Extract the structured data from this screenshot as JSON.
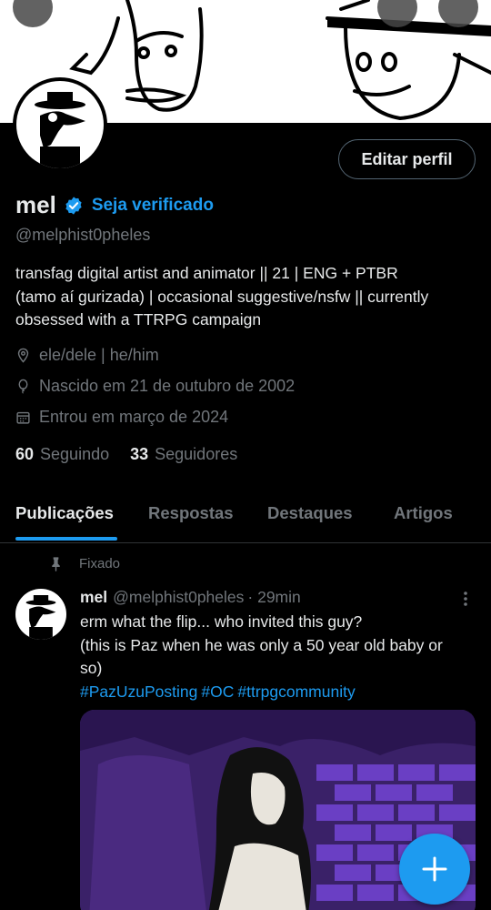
{
  "header": {
    "back_icon": "arrow-left-icon",
    "search_icon": "search-icon",
    "more_icon": "more-vertical-icon"
  },
  "profile": {
    "display_name": "mel",
    "verify_link": "Seja verificado",
    "handle": "@melphist0pheles",
    "edit_button": "Editar perfil",
    "bio_lines": [
      "transfag digital artist and animator  || 21 | ENG + PTBR",
      "(tamo aí gurizada) | occasional suggestive/nsfw || currently",
      "obsessed with a TTRPG campaign"
    ],
    "pronouns": "ele/dele | he/him",
    "birthday": "Nascido em 21 de outubro de 2002",
    "joined": "Entrou em março de 2024",
    "following_count": "60",
    "following_label": "Seguindo",
    "followers_count": "33",
    "followers_label": "Seguidores"
  },
  "tabs": [
    {
      "label": "Publicações",
      "active": true
    },
    {
      "label": "Respostas",
      "active": false
    },
    {
      "label": "Destaques",
      "active": false
    },
    {
      "label": "Artigos",
      "active": false
    }
  ],
  "post": {
    "pinned_label": "Fixado",
    "name": "mel",
    "handle": "@melphist0pheles",
    "time": "· 29min",
    "text_lines": [
      "erm what the flip... who invited this guy?",
      "(this is Paz when he was only a 50 year old baby or",
      "so)"
    ],
    "hashtags": [
      "#PazUzuPosting",
      "#OC",
      "#ttrpgcommunity"
    ]
  },
  "colors": {
    "accent": "#1d9bf0",
    "background": "#000000",
    "text_primary": "#e7e9ea",
    "text_secondary": "#71767b"
  },
  "fab_icon": "plus-icon"
}
